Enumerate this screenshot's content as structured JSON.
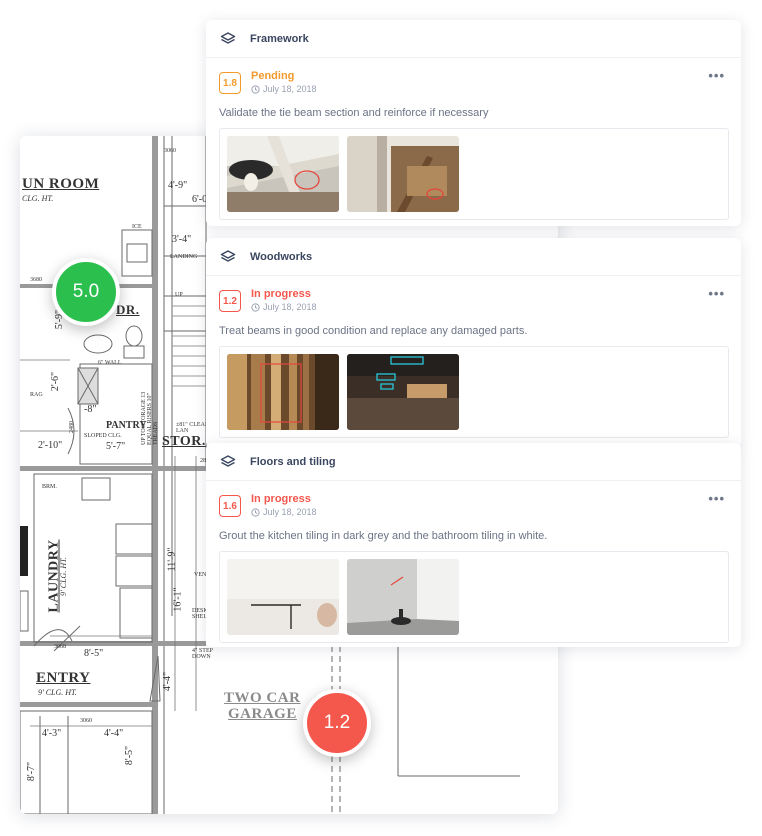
{
  "plan": {
    "labels": {
      "sun_room": "UN ROOM",
      "sun_room_sub": "CLG. HT.",
      "pantry": "PANTRY",
      "pantry_sub": "SLOPED CLG.",
      "pantry_dim": "5'-7\"",
      "stor": "STOR.",
      "laundry": "LAUNDRY",
      "laundry_sub": "9' CLG. HT.",
      "entry": "ENTRY",
      "entry_sub": "9' CLG. HT.",
      "two_car": "TWO CAR",
      "garage": "GARAGE",
      "dr": "DR.",
      "landing": "LANDING",
      "up": "UP",
      "ice": "ICE",
      "brm": "BRM.",
      "dim_4_9": "4'-9\"",
      "dim_6_0": "6'-0",
      "dim_3_4": "3'-4\"",
      "dim_5_9": "5'-9\"",
      "dim_2_6": "2'-6\"",
      "dim_8": "-8\"",
      "dim_2_10": "2'-10\"",
      "dim_11_9": "11'-9\"",
      "dim_16_1": "16'-1\"",
      "dim_8_5": "8'-5\"",
      "dim_4_4": "4'-4\"",
      "dim_4_3": "4'-3\"",
      "dim_4_4b": "4'-4\"",
      "dim_8_7": "8'-7\"",
      "dim_8_5b": "8'-5\"",
      "n3680": "3680",
      "n3060a": "3060",
      "n3060b": "3060",
      "n3068": "3068",
      "n2868": "2868",
      "n2480": "2480",
      "rag": "RAG",
      "wall": "6\" WALL",
      "step": "4\" STEP DOWN",
      "vent": "VEN",
      "desk": "DESK SHEL",
      "clear": "±81\" CLEAR UNDER LAN",
      "stairs": "UP TO STORAGE 13 EQUAL RISERS 10\" TREADS"
    },
    "badges": {
      "green": "5.0",
      "red": "1.2"
    }
  },
  "sections": [
    {
      "title": "Framework",
      "task": {
        "number": "1.8",
        "status": "Pending",
        "status_color": "#f39a2c",
        "date": "July 18, 2018",
        "description": "Validate the tie beam section and reinforce if necessary"
      }
    },
    {
      "title": "Woodworks",
      "task": {
        "number": "1.2",
        "status": "In progress",
        "status_color": "#f4574c",
        "date": "July 18, 2018",
        "description": "Treat beams in good condition and replace any damaged parts."
      }
    },
    {
      "title": "Floors and tiling",
      "task": {
        "number": "1.6",
        "status": "In progress",
        "status_color": "#f4574c",
        "date": "July 18, 2018",
        "description": "Grout the kitchen tiling in dark grey and the bathroom tiling in white."
      }
    }
  ],
  "icons": {
    "section": "layers-icon",
    "date": "clock-icon",
    "menu": "more-icon"
  },
  "more_glyph": "•••"
}
